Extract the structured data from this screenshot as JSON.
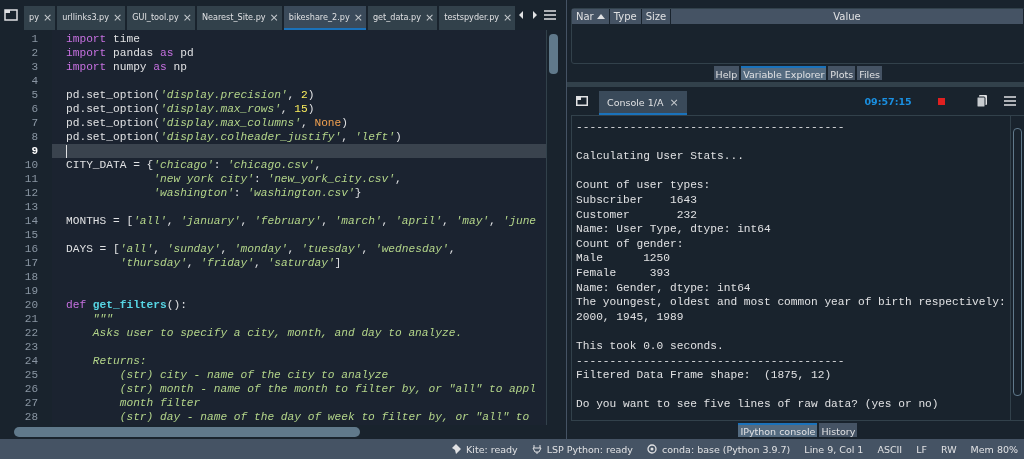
{
  "editor": {
    "tabs": [
      {
        "label": "py",
        "selected": false
      },
      {
        "label": "urllinks3.py",
        "selected": false
      },
      {
        "label": "GUI_tool.py",
        "selected": false
      },
      {
        "label": "Nearest_Site.py",
        "selected": false
      },
      {
        "label": "bikeshare_2.py",
        "selected": true
      },
      {
        "label": "get_data.py",
        "selected": false
      },
      {
        "label": "testspyder.py",
        "selected": false
      }
    ],
    "close_glyph": "×",
    "lines": [
      {
        "number": "1",
        "current": false,
        "tokens": [
          {
            "kind": "kw",
            "text": "import"
          },
          {
            "kind": "plain",
            "text": " time"
          }
        ]
      },
      {
        "number": "2",
        "current": false,
        "tokens": [
          {
            "kind": "kw",
            "text": "import"
          },
          {
            "kind": "plain",
            "text": " pandas "
          },
          {
            "kind": "kw",
            "text": "as"
          },
          {
            "kind": "plain",
            "text": " pd"
          }
        ]
      },
      {
        "number": "3",
        "current": false,
        "tokens": [
          {
            "kind": "kw",
            "text": "import"
          },
          {
            "kind": "plain",
            "text": " numpy "
          },
          {
            "kind": "kw",
            "text": "as"
          },
          {
            "kind": "plain",
            "text": " np"
          }
        ]
      },
      {
        "number": "4",
        "current": false
      },
      {
        "number": "5",
        "current": false,
        "tokens": [
          {
            "kind": "plain",
            "text": "pd.set_option("
          },
          {
            "kind": "str",
            "text": "'display.precision'"
          },
          {
            "kind": "plain",
            "text": ", "
          },
          {
            "kind": "num",
            "text": "2"
          },
          {
            "kind": "plain",
            "text": ")"
          }
        ]
      },
      {
        "number": "6",
        "current": false,
        "tokens": [
          {
            "kind": "plain",
            "text": "pd.set_option("
          },
          {
            "kind": "str",
            "text": "'display.max_rows'"
          },
          {
            "kind": "plain",
            "text": ", "
          },
          {
            "kind": "num",
            "text": "15"
          },
          {
            "kind": "plain",
            "text": ")"
          }
        ]
      },
      {
        "number": "7",
        "current": false,
        "tokens": [
          {
            "kind": "plain",
            "text": "pd.set_option("
          },
          {
            "kind": "str",
            "text": "'display.max_columns'"
          },
          {
            "kind": "plain",
            "text": ", "
          },
          {
            "kind": "const",
            "text": "None"
          },
          {
            "kind": "plain",
            "text": ")"
          }
        ]
      },
      {
        "number": "8",
        "current": false,
        "tokens": [
          {
            "kind": "plain",
            "text": "pd.set_option("
          },
          {
            "kind": "str",
            "text": "'display.colheader_justify'"
          },
          {
            "kind": "plain",
            "text": ", "
          },
          {
            "kind": "str",
            "text": "'left'"
          },
          {
            "kind": "plain",
            "text": ")"
          }
        ]
      },
      {
        "number": "9",
        "current": true
      },
      {
        "number": "10",
        "current": false,
        "tokens": [
          {
            "kind": "plain",
            "text": "CITY_DATA = {"
          },
          {
            "kind": "str",
            "text": "'chicago'"
          },
          {
            "kind": "plain",
            "text": ": "
          },
          {
            "kind": "str",
            "text": "'chicago.csv'"
          },
          {
            "kind": "plain",
            "text": ","
          }
        ]
      },
      {
        "number": "11",
        "current": false,
        "tokens": [
          {
            "kind": "str",
            "text": "             'new york city'"
          },
          {
            "kind": "plain",
            "text": ": "
          },
          {
            "kind": "str",
            "text": "'new_york_city.csv'"
          },
          {
            "kind": "plain",
            "text": ","
          }
        ]
      },
      {
        "number": "12",
        "current": false,
        "tokens": [
          {
            "kind": "str",
            "text": "             'washington'"
          },
          {
            "kind": "plain",
            "text": ": "
          },
          {
            "kind": "str",
            "text": "'washington.csv'"
          },
          {
            "kind": "plain",
            "text": "}"
          }
        ]
      },
      {
        "number": "13",
        "current": false
      },
      {
        "number": "14",
        "current": false,
        "tokens": [
          {
            "kind": "plain",
            "text": "MONTHS = ["
          },
          {
            "kind": "str",
            "text": "'all'"
          },
          {
            "kind": "plain",
            "text": ", "
          },
          {
            "kind": "str",
            "text": "'january'"
          },
          {
            "kind": "plain",
            "text": ", "
          },
          {
            "kind": "str",
            "text": "'february'"
          },
          {
            "kind": "plain",
            "text": ", "
          },
          {
            "kind": "str",
            "text": "'march'"
          },
          {
            "kind": "plain",
            "text": ", "
          },
          {
            "kind": "str",
            "text": "'april'"
          },
          {
            "kind": "plain",
            "text": ", "
          },
          {
            "kind": "str",
            "text": "'may'"
          },
          {
            "kind": "plain",
            "text": ", "
          },
          {
            "kind": "str",
            "text": "'june"
          }
        ]
      },
      {
        "number": "15",
        "current": false
      },
      {
        "number": "16",
        "current": false,
        "tokens": [
          {
            "kind": "plain",
            "text": "DAYS = ["
          },
          {
            "kind": "str",
            "text": "'all'"
          },
          {
            "kind": "plain",
            "text": ", "
          },
          {
            "kind": "str",
            "text": "'sunday'"
          },
          {
            "kind": "plain",
            "text": ", "
          },
          {
            "kind": "str",
            "text": "'monday'"
          },
          {
            "kind": "plain",
            "text": ", "
          },
          {
            "kind": "str",
            "text": "'tuesday'"
          },
          {
            "kind": "plain",
            "text": ", "
          },
          {
            "kind": "str",
            "text": "'wednesday'"
          },
          {
            "kind": "plain",
            "text": ","
          }
        ]
      },
      {
        "number": "17",
        "current": false,
        "tokens": [
          {
            "kind": "str",
            "text": "        'thursday'"
          },
          {
            "kind": "plain",
            "text": ", "
          },
          {
            "kind": "str",
            "text": "'friday'"
          },
          {
            "kind": "plain",
            "text": ", "
          },
          {
            "kind": "str",
            "text": "'saturday'"
          },
          {
            "kind": "plain",
            "text": "]"
          }
        ]
      },
      {
        "number": "18",
        "current": false
      },
      {
        "number": "19",
        "current": false
      },
      {
        "number": "20",
        "current": false,
        "tokens": [
          {
            "kind": "kw",
            "text": "def "
          },
          {
            "kind": "fn",
            "text": "get_filters"
          },
          {
            "kind": "plain",
            "text": "():"
          }
        ]
      },
      {
        "number": "21",
        "current": false,
        "tokens": [
          {
            "kind": "doc",
            "text": "    \"\"\""
          }
        ]
      },
      {
        "number": "22",
        "current": false,
        "tokens": [
          {
            "kind": "doc",
            "text": "    Asks user to specify a city, month, and day to analyze."
          }
        ]
      },
      {
        "number": "23",
        "current": false
      },
      {
        "number": "24",
        "current": false,
        "tokens": [
          {
            "kind": "doc",
            "text": "    Returns:"
          }
        ]
      },
      {
        "number": "25",
        "current": false,
        "tokens": [
          {
            "kind": "doc",
            "text": "        (str) city - name of the city to analyze"
          }
        ]
      },
      {
        "number": "26",
        "current": false,
        "tokens": [
          {
            "kind": "doc",
            "text": "        (str) month - name of the month to filter by, or \"all\" to appl"
          }
        ]
      },
      {
        "number": "27",
        "current": false,
        "tokens": [
          {
            "kind": "doc",
            "text": "        month filter"
          }
        ]
      },
      {
        "number": "28",
        "current": false,
        "tokens": [
          {
            "kind": "doc",
            "text": "        (str) day - name of the day of week to filter by, or \"all\" to"
          }
        ]
      }
    ]
  },
  "variable_explorer": {
    "columns": [
      "Nar",
      "Type",
      "Size",
      "Value"
    ]
  },
  "top_tabs": [
    {
      "label": "Help",
      "selected": false
    },
    {
      "label": "Variable Explorer",
      "selected": true
    },
    {
      "label": "Plots",
      "selected": false
    },
    {
      "label": "Files",
      "selected": false
    }
  ],
  "console": {
    "tab": "Console 1/A",
    "close_glyph": "×",
    "time": "09:57:15",
    "output_blocks": [
      [
        "----------------------------------------"
      ],
      [
        "Calculating User Stats..."
      ],
      [
        "Count of user types:",
        "Subscriber    1643",
        "Customer       232",
        "Name: User Type, dtype: int64",
        "Count of gender:",
        "Male      1250",
        "Female     393",
        "Name: Gender, dtype: int64",
        "The youngest, oldest and most common year of birth respectively:",
        "2000, 1945, 1989"
      ],
      [
        "This took 0.0 seconds.",
        "----------------------------------------",
        "Filtered Data Frame shape:  (1875, 12)"
      ],
      [
        "Do you want to see five lines of raw data? (yes or no)"
      ]
    ]
  },
  "bottom_tabs": [
    {
      "label": "IPython console",
      "selected": true
    },
    {
      "label": "History",
      "selected": false
    }
  ],
  "status_bar": {
    "kite": "Kite: ready",
    "lsp": "LSP Python: ready",
    "conda": "conda: base (Python 3.9.7)",
    "position": "Line 9, Col 1",
    "encoding": "ASCII",
    "eol": "LF",
    "mode": "RW",
    "memory": "Mem 80%"
  }
}
